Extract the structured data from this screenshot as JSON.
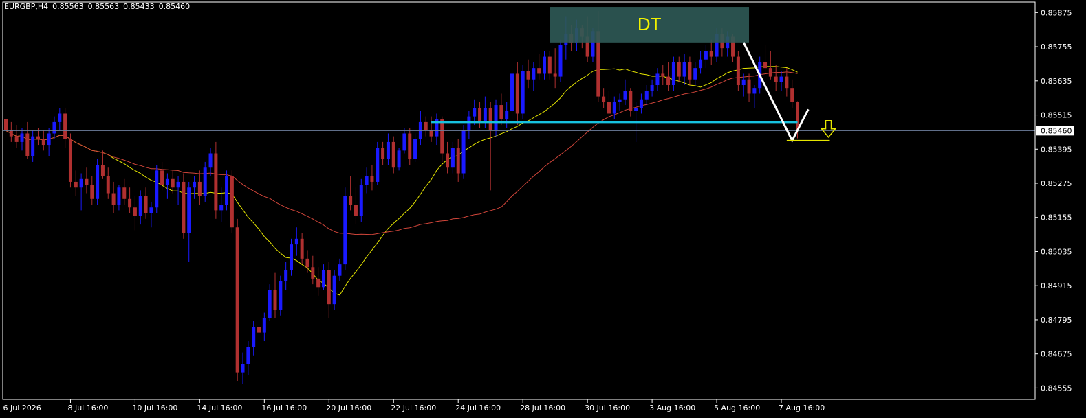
{
  "header": {
    "symbol": "EURGBP,H4",
    "open": "0.85563",
    "high": "0.85563",
    "low": "0.85433",
    "close": "0.85460"
  },
  "annotation": {
    "label": "DT"
  },
  "price_label": "0.85460",
  "colors": {
    "background": "#000000",
    "bull": "#1a1aff",
    "bear": "#b03030",
    "ma_fast": "#e6e600",
    "ma_slow": "#d0453a",
    "support_line": "#17c1de",
    "current_price_line": "#6e7f9e",
    "pattern_box": "#2f5a57",
    "annotation_text": "#f2f200",
    "arrow": "#e6e600",
    "axis": "#ffffff"
  },
  "chart_data": {
    "type": "candlestick",
    "symbol": "EURGBP",
    "timeframe": "H4",
    "ylim": [
      0.84515,
      0.85912
    ],
    "yticks": [
      "0.85875",
      "0.85755",
      "0.85635",
      "0.85515",
      "0.85395",
      "0.85275",
      "0.85155",
      "0.85035",
      "0.84915",
      "0.84795",
      "0.84675",
      "0.84555"
    ],
    "xticks": [
      {
        "index": 0,
        "label": "6 Jul 2026"
      },
      {
        "index": 12,
        "label": "8 Jul 16:00"
      },
      {
        "index": 24,
        "label": "10 Jul 16:00"
      },
      {
        "index": 36,
        "label": "14 Jul 16:00"
      },
      {
        "index": 48,
        "label": "16 Jul 16:00"
      },
      {
        "index": 60,
        "label": "20 Jul 16:00"
      },
      {
        "index": 72,
        "label": "22 Jul 16:00"
      },
      {
        "index": 84,
        "label": "24 Jul 16:00"
      },
      {
        "index": 96,
        "label": "28 Jul 16:00"
      },
      {
        "index": 108,
        "label": "30 Jul 16:00"
      },
      {
        "index": 120,
        "label": "3 Aug 16:00"
      },
      {
        "index": 132,
        "label": "5 Aug 16:00"
      },
      {
        "index": 144,
        "label": "7 Aug 16:00"
      }
    ],
    "candles": [
      {
        "o": 0.855,
        "h": 0.8555,
        "l": 0.8543,
        "c": 0.8546
      },
      {
        "o": 0.8546,
        "h": 0.8549,
        "l": 0.8542,
        "c": 0.8544
      },
      {
        "o": 0.8544,
        "h": 0.8548,
        "l": 0.854,
        "c": 0.8542
      },
      {
        "o": 0.8542,
        "h": 0.8547,
        "l": 0.8539,
        "c": 0.8545
      },
      {
        "o": 0.8545,
        "h": 0.8549,
        "l": 0.8536,
        "c": 0.8537
      },
      {
        "o": 0.8537,
        "h": 0.8546,
        "l": 0.8535,
        "c": 0.8544
      },
      {
        "o": 0.8544,
        "h": 0.8547,
        "l": 0.8541,
        "c": 0.8543
      },
      {
        "o": 0.8543,
        "h": 0.8546,
        "l": 0.8539,
        "c": 0.8541
      },
      {
        "o": 0.8541,
        "h": 0.8547,
        "l": 0.8537,
        "c": 0.8545
      },
      {
        "o": 0.8545,
        "h": 0.8551,
        "l": 0.8543,
        "c": 0.8549
      },
      {
        "o": 0.8549,
        "h": 0.8554,
        "l": 0.8546,
        "c": 0.8552
      },
      {
        "o": 0.8552,
        "h": 0.8554,
        "l": 0.854,
        "c": 0.8543
      },
      {
        "o": 0.8543,
        "h": 0.8545,
        "l": 0.8526,
        "c": 0.8528
      },
      {
        "o": 0.8528,
        "h": 0.8532,
        "l": 0.8523,
        "c": 0.8526
      },
      {
        "o": 0.8526,
        "h": 0.8531,
        "l": 0.8518,
        "c": 0.8529
      },
      {
        "o": 0.8529,
        "h": 0.8533,
        "l": 0.8524,
        "c": 0.8527
      },
      {
        "o": 0.8527,
        "h": 0.853,
        "l": 0.852,
        "c": 0.8522
      },
      {
        "o": 0.8522,
        "h": 0.8536,
        "l": 0.852,
        "c": 0.8534
      },
      {
        "o": 0.8534,
        "h": 0.8539,
        "l": 0.8529,
        "c": 0.853
      },
      {
        "o": 0.853,
        "h": 0.8533,
        "l": 0.8522,
        "c": 0.8524
      },
      {
        "o": 0.8524,
        "h": 0.8528,
        "l": 0.8517,
        "c": 0.852
      },
      {
        "o": 0.852,
        "h": 0.8527,
        "l": 0.8518,
        "c": 0.8526
      },
      {
        "o": 0.8526,
        "h": 0.8529,
        "l": 0.852,
        "c": 0.8522
      },
      {
        "o": 0.8522,
        "h": 0.8526,
        "l": 0.8517,
        "c": 0.8519
      },
      {
        "o": 0.8519,
        "h": 0.8523,
        "l": 0.8511,
        "c": 0.8516
      },
      {
        "o": 0.8516,
        "h": 0.8525,
        "l": 0.8513,
        "c": 0.8523
      },
      {
        "o": 0.8523,
        "h": 0.8526,
        "l": 0.8515,
        "c": 0.8517
      },
      {
        "o": 0.8517,
        "h": 0.8521,
        "l": 0.8512,
        "c": 0.8519
      },
      {
        "o": 0.8519,
        "h": 0.8534,
        "l": 0.8517,
        "c": 0.8532
      },
      {
        "o": 0.8532,
        "h": 0.8535,
        "l": 0.8525,
        "c": 0.8527
      },
      {
        "o": 0.8527,
        "h": 0.8531,
        "l": 0.8522,
        "c": 0.8529
      },
      {
        "o": 0.8529,
        "h": 0.8532,
        "l": 0.8524,
        "c": 0.8526
      },
      {
        "o": 0.8526,
        "h": 0.853,
        "l": 0.852,
        "c": 0.8528
      },
      {
        "o": 0.8528,
        "h": 0.8531,
        "l": 0.8508,
        "c": 0.851
      },
      {
        "o": 0.851,
        "h": 0.8528,
        "l": 0.85,
        "c": 0.8526
      },
      {
        "o": 0.8526,
        "h": 0.853,
        "l": 0.8522,
        "c": 0.8528
      },
      {
        "o": 0.8528,
        "h": 0.8532,
        "l": 0.852,
        "c": 0.8523
      },
      {
        "o": 0.8523,
        "h": 0.8535,
        "l": 0.8521,
        "c": 0.8533
      },
      {
        "o": 0.8533,
        "h": 0.854,
        "l": 0.853,
        "c": 0.8538
      },
      {
        "o": 0.8538,
        "h": 0.8542,
        "l": 0.8515,
        "c": 0.8518
      },
      {
        "o": 0.8518,
        "h": 0.8526,
        "l": 0.8514,
        "c": 0.852
      },
      {
        "o": 0.852,
        "h": 0.8532,
        "l": 0.8518,
        "c": 0.853
      },
      {
        "o": 0.853,
        "h": 0.8532,
        "l": 0.851,
        "c": 0.8512
      },
      {
        "o": 0.8512,
        "h": 0.8515,
        "l": 0.8458,
        "c": 0.8461
      },
      {
        "o": 0.8461,
        "h": 0.8468,
        "l": 0.8457,
        "c": 0.8464
      },
      {
        "o": 0.8464,
        "h": 0.8472,
        "l": 0.846,
        "c": 0.847
      },
      {
        "o": 0.847,
        "h": 0.8479,
        "l": 0.8467,
        "c": 0.8477
      },
      {
        "o": 0.8477,
        "h": 0.8482,
        "l": 0.8472,
        "c": 0.8475
      },
      {
        "o": 0.8475,
        "h": 0.8482,
        "l": 0.8472,
        "c": 0.848
      },
      {
        "o": 0.848,
        "h": 0.8492,
        "l": 0.8479,
        "c": 0.849
      },
      {
        "o": 0.849,
        "h": 0.8496,
        "l": 0.848,
        "c": 0.8483
      },
      {
        "o": 0.8483,
        "h": 0.8495,
        "l": 0.8481,
        "c": 0.8493
      },
      {
        "o": 0.8493,
        "h": 0.85,
        "l": 0.849,
        "c": 0.8497
      },
      {
        "o": 0.8497,
        "h": 0.8508,
        "l": 0.8495,
        "c": 0.8506
      },
      {
        "o": 0.8506,
        "h": 0.8512,
        "l": 0.8502,
        "c": 0.8508
      },
      {
        "o": 0.8508,
        "h": 0.851,
        "l": 0.8499,
        "c": 0.8501
      },
      {
        "o": 0.8501,
        "h": 0.8504,
        "l": 0.8496,
        "c": 0.8498
      },
      {
        "o": 0.8498,
        "h": 0.8502,
        "l": 0.8492,
        "c": 0.8494
      },
      {
        "o": 0.8494,
        "h": 0.8498,
        "l": 0.8488,
        "c": 0.8491
      },
      {
        "o": 0.8491,
        "h": 0.8499,
        "l": 0.849,
        "c": 0.8497
      },
      {
        "o": 0.8497,
        "h": 0.85,
        "l": 0.848,
        "c": 0.8485
      },
      {
        "o": 0.8485,
        "h": 0.8497,
        "l": 0.8483,
        "c": 0.8495
      },
      {
        "o": 0.8495,
        "h": 0.8501,
        "l": 0.8493,
        "c": 0.8499
      },
      {
        "o": 0.8499,
        "h": 0.8526,
        "l": 0.8497,
        "c": 0.8523
      },
      {
        "o": 0.8523,
        "h": 0.853,
        "l": 0.8518,
        "c": 0.852
      },
      {
        "o": 0.852,
        "h": 0.8526,
        "l": 0.8513,
        "c": 0.8516
      },
      {
        "o": 0.8516,
        "h": 0.8529,
        "l": 0.8514,
        "c": 0.8527
      },
      {
        "o": 0.8527,
        "h": 0.8533,
        "l": 0.8524,
        "c": 0.853
      },
      {
        "o": 0.853,
        "h": 0.8534,
        "l": 0.8525,
        "c": 0.8528
      },
      {
        "o": 0.8528,
        "h": 0.8542,
        "l": 0.8527,
        "c": 0.854
      },
      {
        "o": 0.854,
        "h": 0.8542,
        "l": 0.8534,
        "c": 0.8536
      },
      {
        "o": 0.8536,
        "h": 0.8545,
        "l": 0.8534,
        "c": 0.8542
      },
      {
        "o": 0.8542,
        "h": 0.8544,
        "l": 0.8531,
        "c": 0.8533
      },
      {
        "o": 0.8533,
        "h": 0.854,
        "l": 0.8532,
        "c": 0.8539
      },
      {
        "o": 0.8539,
        "h": 0.8547,
        "l": 0.8538,
        "c": 0.8545
      },
      {
        "o": 0.8545,
        "h": 0.8547,
        "l": 0.8534,
        "c": 0.8536
      },
      {
        "o": 0.8536,
        "h": 0.8545,
        "l": 0.8535,
        "c": 0.8543
      },
      {
        "o": 0.8543,
        "h": 0.8553,
        "l": 0.8541,
        "c": 0.8549
      },
      {
        "o": 0.8549,
        "h": 0.8551,
        "l": 0.8544,
        "c": 0.8546
      },
      {
        "o": 0.8546,
        "h": 0.8551,
        "l": 0.8542,
        "c": 0.8544
      },
      {
        "o": 0.8544,
        "h": 0.8552,
        "l": 0.8541,
        "c": 0.855
      },
      {
        "o": 0.855,
        "h": 0.8551,
        "l": 0.8535,
        "c": 0.8538
      },
      {
        "o": 0.8538,
        "h": 0.8542,
        "l": 0.8531,
        "c": 0.8533
      },
      {
        "o": 0.8533,
        "h": 0.8542,
        "l": 0.8531,
        "c": 0.854
      },
      {
        "o": 0.854,
        "h": 0.8543,
        "l": 0.8528,
        "c": 0.8531
      },
      {
        "o": 0.8531,
        "h": 0.8548,
        "l": 0.8529,
        "c": 0.8546
      },
      {
        "o": 0.8546,
        "h": 0.8553,
        "l": 0.8543,
        "c": 0.8551
      },
      {
        "o": 0.8551,
        "h": 0.8557,
        "l": 0.8548,
        "c": 0.8554
      },
      {
        "o": 0.8554,
        "h": 0.8556,
        "l": 0.8547,
        "c": 0.8549
      },
      {
        "o": 0.8549,
        "h": 0.8558,
        "l": 0.8547,
        "c": 0.8554
      },
      {
        "o": 0.8554,
        "h": 0.8556,
        "l": 0.8525,
        "c": 0.8546
      },
      {
        "o": 0.8546,
        "h": 0.8557,
        "l": 0.8544,
        "c": 0.8555
      },
      {
        "o": 0.8555,
        "h": 0.8559,
        "l": 0.8548,
        "c": 0.855
      },
      {
        "o": 0.855,
        "h": 0.8556,
        "l": 0.8547,
        "c": 0.8553
      },
      {
        "o": 0.8553,
        "h": 0.8568,
        "l": 0.855,
        "c": 0.8566
      },
      {
        "o": 0.8566,
        "h": 0.857,
        "l": 0.8548,
        "c": 0.8552
      },
      {
        "o": 0.8552,
        "h": 0.8569,
        "l": 0.855,
        "c": 0.8567
      },
      {
        "o": 0.8567,
        "h": 0.8571,
        "l": 0.8561,
        "c": 0.8564
      },
      {
        "o": 0.8564,
        "h": 0.857,
        "l": 0.856,
        "c": 0.8568
      },
      {
        "o": 0.8568,
        "h": 0.8573,
        "l": 0.8564,
        "c": 0.8566
      },
      {
        "o": 0.8566,
        "h": 0.8574,
        "l": 0.8564,
        "c": 0.8572
      },
      {
        "o": 0.8572,
        "h": 0.8574,
        "l": 0.8564,
        "c": 0.8566
      },
      {
        "o": 0.8566,
        "h": 0.8575,
        "l": 0.8561,
        "c": 0.8565
      },
      {
        "o": 0.8565,
        "h": 0.8578,
        "l": 0.8563,
        "c": 0.8576
      },
      {
        "o": 0.8576,
        "h": 0.8586,
        "l": 0.8571,
        "c": 0.858
      },
      {
        "o": 0.858,
        "h": 0.8583,
        "l": 0.8574,
        "c": 0.8577
      },
      {
        "o": 0.8577,
        "h": 0.8585,
        "l": 0.8574,
        "c": 0.8582
      },
      {
        "o": 0.8582,
        "h": 0.8583,
        "l": 0.8575,
        "c": 0.8579
      },
      {
        "o": 0.8579,
        "h": 0.8586,
        "l": 0.857,
        "c": 0.8572
      },
      {
        "o": 0.8572,
        "h": 0.8582,
        "l": 0.857,
        "c": 0.8581
      },
      {
        "o": 0.8581,
        "h": 0.8588,
        "l": 0.8556,
        "c": 0.8558
      },
      {
        "o": 0.8558,
        "h": 0.8561,
        "l": 0.8554,
        "c": 0.8556
      },
      {
        "o": 0.8556,
        "h": 0.856,
        "l": 0.855,
        "c": 0.8552
      },
      {
        "o": 0.8552,
        "h": 0.8558,
        "l": 0.855,
        "c": 0.8556
      },
      {
        "o": 0.8556,
        "h": 0.8559,
        "l": 0.8553,
        "c": 0.8557
      },
      {
        "o": 0.8557,
        "h": 0.8564,
        "l": 0.8555,
        "c": 0.856
      },
      {
        "o": 0.856,
        "h": 0.8561,
        "l": 0.8551,
        "c": 0.8553
      },
      {
        "o": 0.8553,
        "h": 0.8556,
        "l": 0.8542,
        "c": 0.8554
      },
      {
        "o": 0.8554,
        "h": 0.8559,
        "l": 0.8552,
        "c": 0.8557
      },
      {
        "o": 0.8557,
        "h": 0.8562,
        "l": 0.8555,
        "c": 0.856
      },
      {
        "o": 0.856,
        "h": 0.8564,
        "l": 0.8558,
        "c": 0.8562
      },
      {
        "o": 0.8562,
        "h": 0.8568,
        "l": 0.856,
        "c": 0.8566
      },
      {
        "o": 0.8566,
        "h": 0.8569,
        "l": 0.8562,
        "c": 0.8565
      },
      {
        "o": 0.8565,
        "h": 0.857,
        "l": 0.856,
        "c": 0.8562
      },
      {
        "o": 0.8562,
        "h": 0.8572,
        "l": 0.856,
        "c": 0.857
      },
      {
        "o": 0.857,
        "h": 0.8572,
        "l": 0.8563,
        "c": 0.8565
      },
      {
        "o": 0.8565,
        "h": 0.8573,
        "l": 0.8562,
        "c": 0.857
      },
      {
        "o": 0.857,
        "h": 0.8572,
        "l": 0.8562,
        "c": 0.8564
      },
      {
        "o": 0.8564,
        "h": 0.857,
        "l": 0.8562,
        "c": 0.8568
      },
      {
        "o": 0.8568,
        "h": 0.8574,
        "l": 0.8566,
        "c": 0.8571
      },
      {
        "o": 0.8571,
        "h": 0.8576,
        "l": 0.8568,
        "c": 0.8574
      },
      {
        "o": 0.8574,
        "h": 0.8578,
        "l": 0.8569,
        "c": 0.8572
      },
      {
        "o": 0.8572,
        "h": 0.8582,
        "l": 0.857,
        "c": 0.858
      },
      {
        "o": 0.858,
        "h": 0.8582,
        "l": 0.8572,
        "c": 0.8575
      },
      {
        "o": 0.8575,
        "h": 0.8581,
        "l": 0.8572,
        "c": 0.8579
      },
      {
        "o": 0.8579,
        "h": 0.858,
        "l": 0.857,
        "c": 0.8572
      },
      {
        "o": 0.8572,
        "h": 0.8574,
        "l": 0.856,
        "c": 0.8562
      },
      {
        "o": 0.8562,
        "h": 0.8566,
        "l": 0.8558,
        "c": 0.8564
      },
      {
        "o": 0.8564,
        "h": 0.8566,
        "l": 0.8556,
        "c": 0.8559
      },
      {
        "o": 0.8559,
        "h": 0.8562,
        "l": 0.8554,
        "c": 0.8561
      },
      {
        "o": 0.8561,
        "h": 0.8572,
        "l": 0.8559,
        "c": 0.857
      },
      {
        "o": 0.857,
        "h": 0.8576,
        "l": 0.8566,
        "c": 0.8568
      },
      {
        "o": 0.8568,
        "h": 0.8574,
        "l": 0.8564,
        "c": 0.8565
      },
      {
        "o": 0.8565,
        "h": 0.8569,
        "l": 0.856,
        "c": 0.8563
      },
      {
        "o": 0.8563,
        "h": 0.8567,
        "l": 0.856,
        "c": 0.8565
      },
      {
        "o": 0.8565,
        "h": 0.8568,
        "l": 0.8558,
        "c": 0.8561
      },
      {
        "o": 0.8561,
        "h": 0.8564,
        "l": 0.8554,
        "c": 0.8556
      },
      {
        "o": 0.8556,
        "h": 0.85563,
        "l": 0.85433,
        "c": 0.8546
      }
    ],
    "support_level": 0.8549,
    "current_price": 0.8546,
    "pattern": {
      "label": "DT",
      "from_index": 101,
      "to_index": 138,
      "top": 0.85895,
      "bottom": 0.8577
    },
    "projection": [
      {
        "index": 137,
        "value": 0.8577
      },
      {
        "index": 146,
        "value": 0.85425
      },
      {
        "index": 149,
        "value": 0.85535
      }
    ],
    "target": {
      "value": 0.85425,
      "from_index": 145,
      "to_index": 153
    },
    "moving_averages": [
      {
        "kind": "fast",
        "color_key": "ma_fast",
        "period": 20
      },
      {
        "kind": "slow",
        "color_key": "ma_slow",
        "period": 50
      }
    ],
    "grid": false,
    "legend": "none"
  }
}
